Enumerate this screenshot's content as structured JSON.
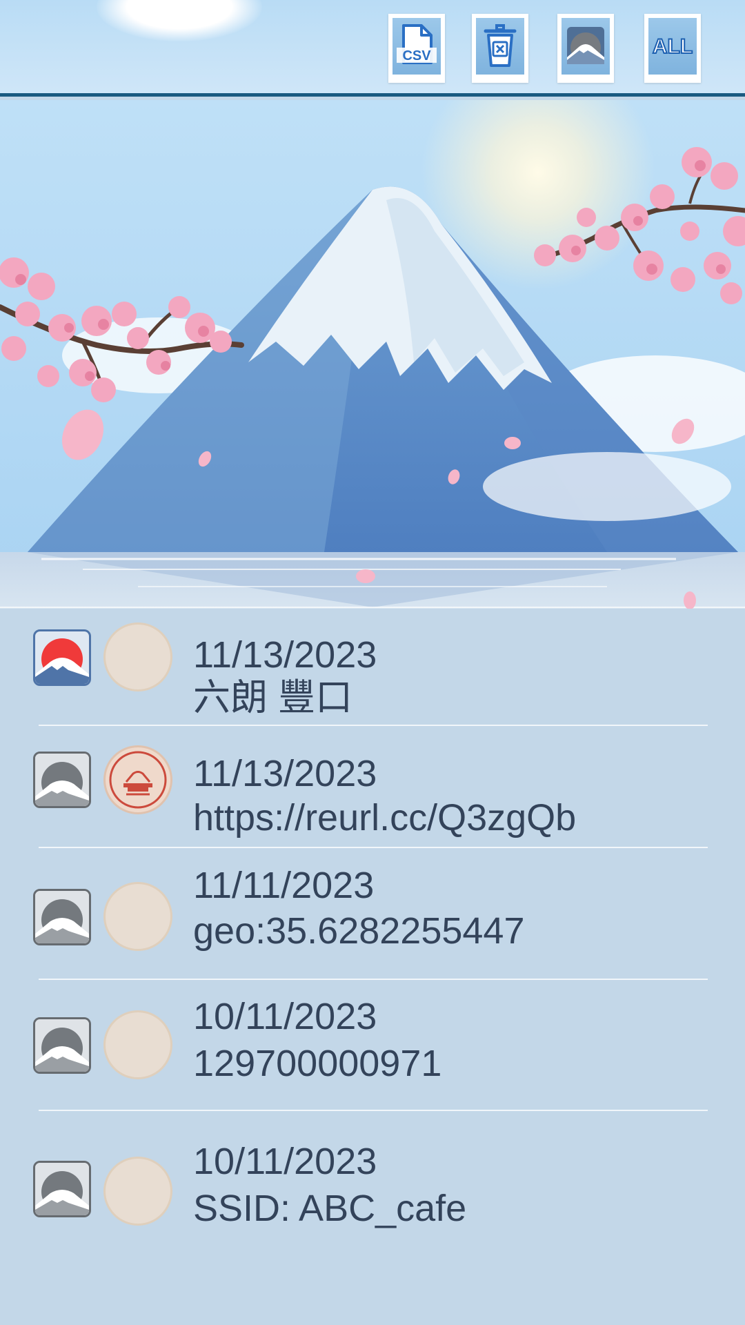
{
  "toolbar": {
    "buttons": [
      {
        "name": "export-csv",
        "label": "CSV",
        "icon": "csv-file-icon"
      },
      {
        "name": "delete",
        "label": "",
        "icon": "trash-icon"
      },
      {
        "name": "filter-fuji",
        "label": "",
        "icon": "fuji-icon"
      },
      {
        "name": "show-all",
        "label": "ALL",
        "icon": "all-icon"
      }
    ]
  },
  "colors": {
    "toolbar_border": "#1a5a80",
    "list_background": "#c3d7e8",
    "text": "#33435a",
    "favorite_red": "#f03a3a",
    "stamp_red": "#cc4a3c"
  },
  "history": [
    {
      "date": "11/13/2023",
      "value": "六朗 豐口",
      "type_icon": "red-fuji-icon",
      "stamp": "none"
    },
    {
      "date": "11/13/2023",
      "value": "https://reurl.cc/Q3zgQb",
      "type_icon": "gray-fuji-icon",
      "stamp": "red-stamp-icon"
    },
    {
      "date": "11/11/2023",
      "value": "geo:35.6282255447",
      "type_icon": "gray-fuji-icon",
      "stamp": "none"
    },
    {
      "date": "10/11/2023",
      "value": "129700000971",
      "type_icon": "gray-fuji-icon",
      "stamp": "none"
    },
    {
      "date": "10/11/2023",
      "value": "SSID: ABC_cafe",
      "type_icon": "gray-fuji-icon",
      "stamp": "none"
    }
  ]
}
